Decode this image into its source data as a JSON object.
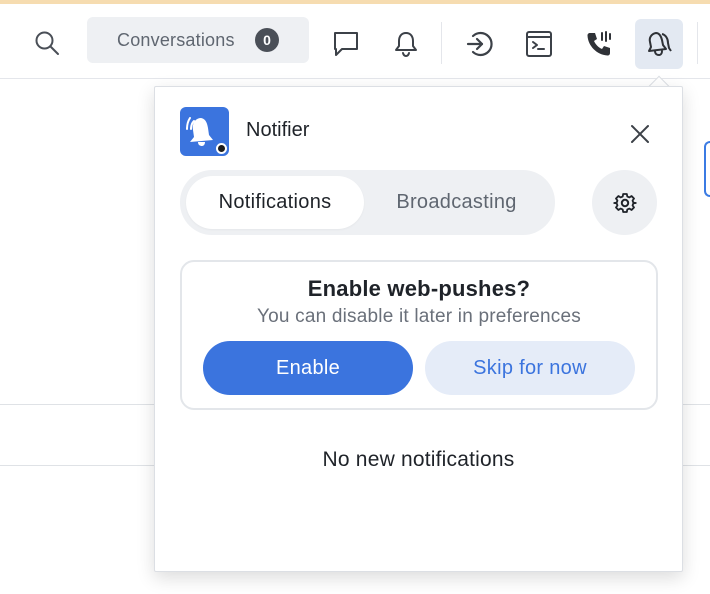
{
  "toolbar": {
    "conversations_label": "Conversations",
    "conversations_count": "0",
    "icons": [
      "search-icon",
      "chat-bubble-icon",
      "bell-icon",
      "login-icon",
      "terminal-icon",
      "phone-icon",
      "notifier-bells-icon"
    ]
  },
  "panel": {
    "app_title": "Notifier",
    "tabs": [
      {
        "label": "Notifications",
        "active": true
      },
      {
        "label": "Broadcasting",
        "active": false
      }
    ],
    "push_prompt": {
      "title": "Enable web-pushes?",
      "subtitle": "You can disable it later in preferences",
      "enable_label": "Enable",
      "skip_label": "Skip for now"
    },
    "empty_message": "No new notifications"
  },
  "colors": {
    "accent": "#3b74de",
    "accent_light": "#e5ecf8",
    "top_accent": "#f6dcb0",
    "pill_bg": "#eef0f3"
  }
}
